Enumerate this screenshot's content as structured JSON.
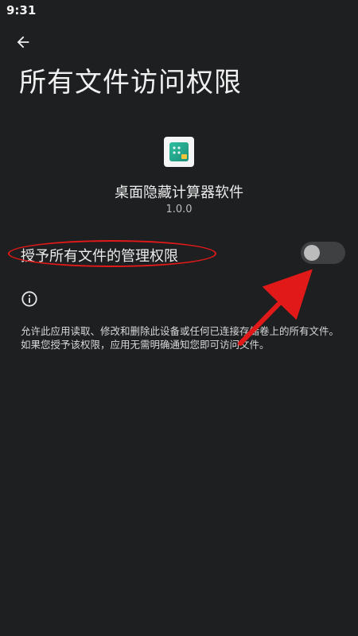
{
  "status_bar": {
    "time": "9:31"
  },
  "header": {
    "title": "所有文件访问权限"
  },
  "app": {
    "name": "桌面隐藏计算器软件",
    "version": "1.0.0"
  },
  "permission": {
    "label": "授予所有文件的管理权限",
    "enabled": false
  },
  "info": {
    "description": "允许此应用读取、修改和删除此设备或任何已连接存储卷上的所有文件。如果您授予该权限，应用无需明确通知您即可访问文件。"
  },
  "icons": {
    "back": "arrow-left-icon",
    "info": "info-icon",
    "app": "calculator-icon"
  },
  "colors": {
    "background": "#1e1f21",
    "annotation": "#e11919",
    "toggle_track": "#3e4042",
    "toggle_thumb": "#bcbcbc"
  }
}
